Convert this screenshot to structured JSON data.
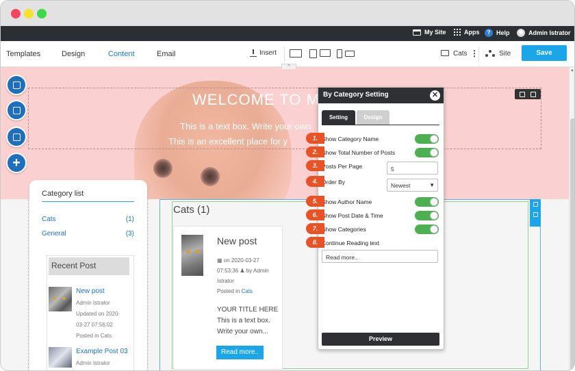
{
  "topbar": {
    "my_site": "My Site",
    "apps": "Apps",
    "help": "Help",
    "user": "Admin Istrator"
  },
  "menu": {
    "tabs": [
      "Templates",
      "Design",
      "Content",
      "Email"
    ],
    "active_tab": "Content",
    "insert": "Insert",
    "cats": "Cats",
    "site": "Site",
    "save": "Save"
  },
  "hero": {
    "title": "WELCOME TO M",
    "line1": "This is a text box. Write your own",
    "line2": "This is an excellent place for y"
  },
  "category_list": {
    "title": "Category list",
    "items": [
      {
        "name": "Cats",
        "count": "(1)"
      },
      {
        "name": "General",
        "count": "(3)"
      }
    ]
  },
  "recent": {
    "title": "Recent Post",
    "posts": [
      {
        "title": "New post",
        "author": "Admin Istrator",
        "updated": "Updated on 2020-",
        "updated2": "03-27 07:56:02",
        "posted": "Posted in Cats"
      },
      {
        "title": "Example Post 03",
        "author": "Admin Istrator"
      }
    ]
  },
  "main": {
    "heading": "Cats (1)",
    "post": {
      "title": "New post",
      "meta1": "on 2020-03-27",
      "meta2": "07:53:36",
      "meta3": "by Admin",
      "meta4": "Istrator",
      "posted_in": "Posted in",
      "category": "Cats",
      "excerpt1": "YOUR TITLE HERE",
      "excerpt2": "This is a text box.",
      "excerpt3": "Write your own...",
      "readmore": "Read more.."
    }
  },
  "panel": {
    "title": "By Category Setting",
    "tab_setting": "Setting",
    "tab_design": "Design",
    "rows": [
      {
        "num": "1.",
        "label": "Show Category Name"
      },
      {
        "num": "2.",
        "label": "Show Total Number of Posts"
      },
      {
        "num": "3.",
        "label": "Posts Per Page"
      },
      {
        "num": "4.",
        "label": "Order By"
      },
      {
        "num": "5.",
        "label": "Show Author Name"
      },
      {
        "num": "6.",
        "label": "Show Post Date & Time"
      },
      {
        "num": "7.",
        "label": "Show Categories"
      },
      {
        "num": "8.",
        "label": "Continue Reading text"
      }
    ],
    "posts_per_page": "5",
    "order_by": "Newest",
    "continue_text": "Read more..",
    "preview": "Preview"
  },
  "colors": {
    "accent": "#1aa6e9",
    "toggle_on": "#4caf50",
    "badge": "#e85224",
    "hero_bg": "#fbd0d0",
    "dark": "#2e3033"
  },
  "icons": [
    "my-site-icon",
    "apps-icon",
    "help-icon",
    "user-avatar-icon",
    "download-icon",
    "desktop-icon",
    "tablet-icon",
    "mobile-icon",
    "folder-icon",
    "kebab-icon",
    "site-icon",
    "close-icon",
    "edit-icon",
    "move-icon",
    "plus-icon"
  ]
}
